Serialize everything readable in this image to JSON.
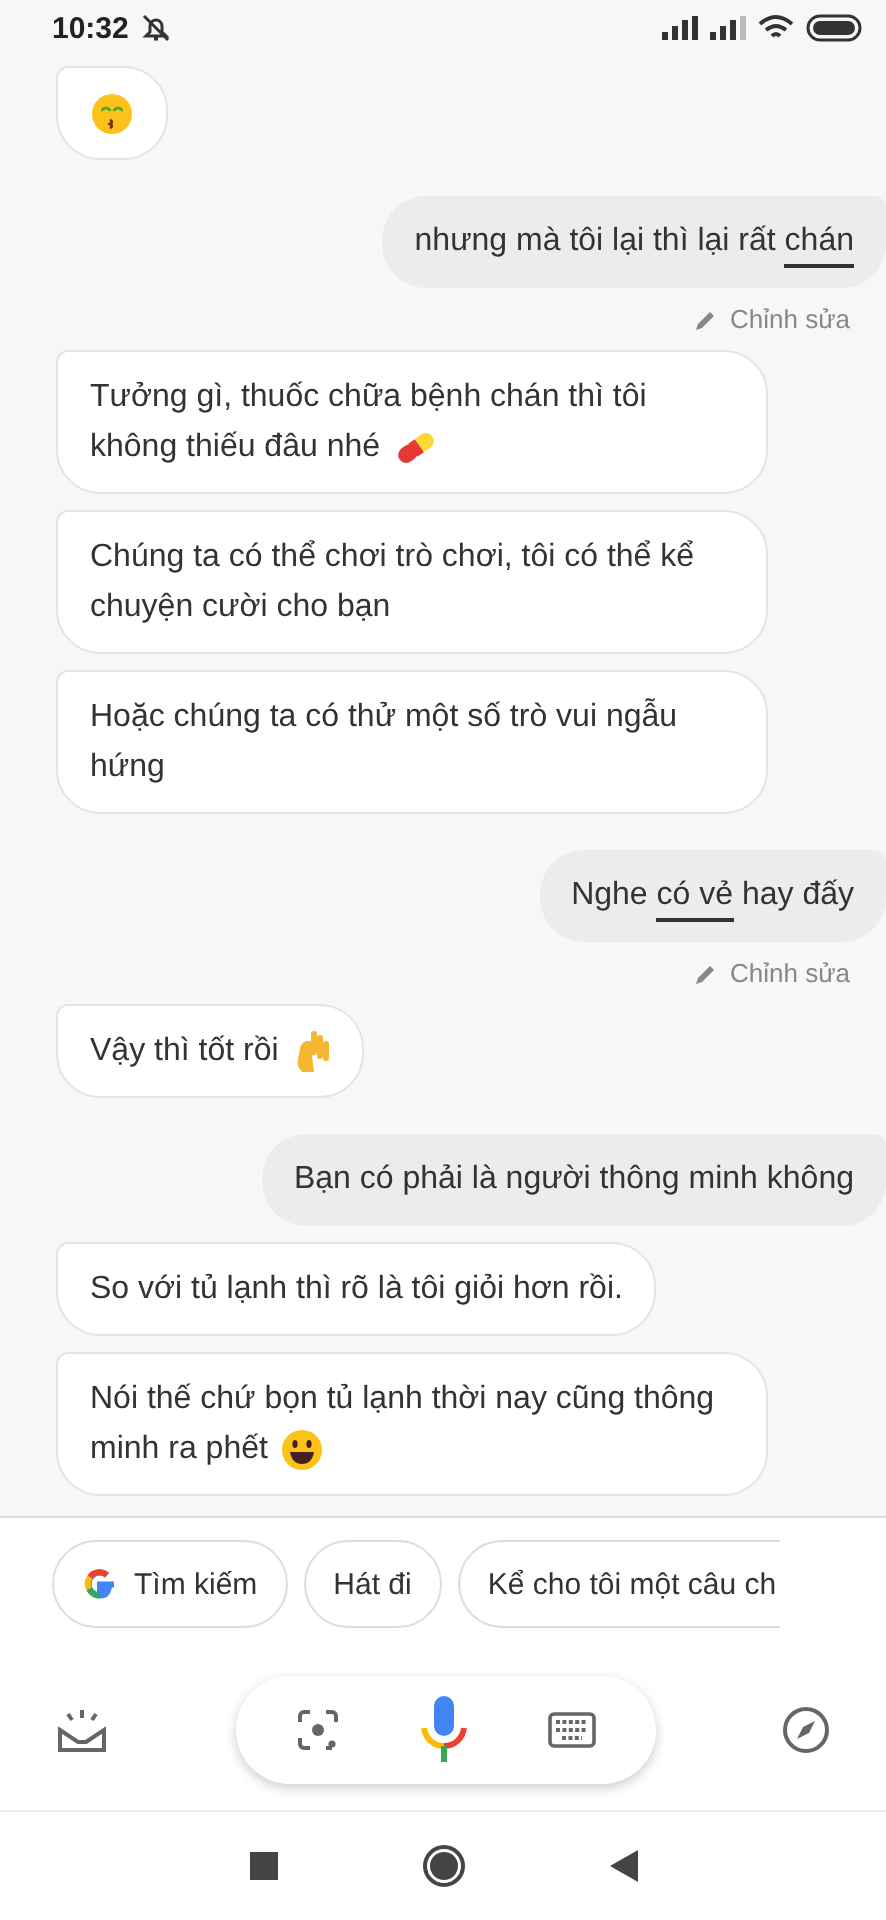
{
  "status_bar": {
    "time": "10:32"
  },
  "messages": [
    {
      "kind": "bot",
      "emoji": {
        "kind": "kiss"
      }
    },
    {
      "kind": "user",
      "parts": [
        {
          "text": "nhưng mà tôi lại thì lại rất ",
          "underlined": false
        },
        {
          "text": "chán",
          "underlined": true
        }
      ],
      "edit": "Chỉnh sửa"
    },
    {
      "kind": "bot",
      "text": "Tưởng gì, thuốc chữa bệnh chán thì tôi không thiếu đâu nhé",
      "emoji": {
        "kind": "pill"
      }
    },
    {
      "kind": "bot",
      "text": "Chúng ta có thể chơi trò chơi, tôi có thể kể chuyện cười cho bạn"
    },
    {
      "kind": "bot",
      "text": "Hoặc chúng ta có thử một số trò vui ngẫu hứng"
    },
    {
      "kind": "user",
      "parts": [
        {
          "text": "Nghe ",
          "underlined": false
        },
        {
          "text": "có vẻ",
          "underlined": true
        },
        {
          "text": " hay đấy",
          "underlined": false
        }
      ],
      "edit": "Chỉnh sửa"
    },
    {
      "kind": "bot",
      "text": "Vậy thì tốt rồi",
      "emoji": {
        "kind": "ok-hand"
      }
    },
    {
      "kind": "user",
      "parts": [
        {
          "text": "Bạn có phải là người thông minh không",
          "underlined": false
        }
      ]
    },
    {
      "kind": "bot",
      "text": "So với tủ lạnh thì rõ là tôi giỏi hơn rồi."
    },
    {
      "kind": "bot",
      "text": "Nói thế chứ bọn tủ lạnh thời nay cũng thông minh ra phết",
      "emoji": {
        "kind": "smile"
      }
    }
  ],
  "suggestions": [
    {
      "label": "Tìm kiếm",
      "kind": "search"
    },
    {
      "label": "Hát đi",
      "kind": "plain"
    },
    {
      "label": "Kể cho tôi một câu ch",
      "kind": "plain"
    }
  ]
}
